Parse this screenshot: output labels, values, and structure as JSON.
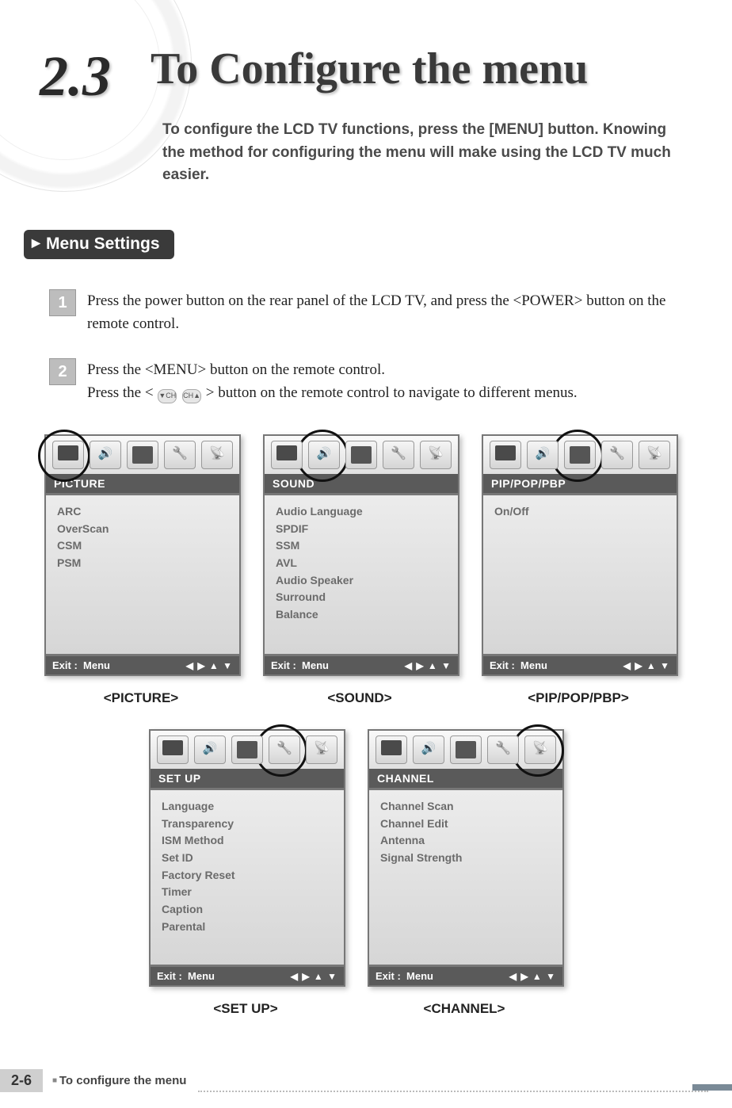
{
  "section_number": "2.3",
  "title": "To Configure the menu",
  "subtitle": "To configure the LCD TV functions, press the [MENU] button. Knowing the method for configuring the menu will make using the LCD TV much easier.",
  "tab_heading": "Menu Settings",
  "steps": {
    "s1_num": "1",
    "s1_text": "Press the power button on the rear panel of the LCD TV, and press the <POWER> button on the remote control.",
    "s2_num": "2",
    "s2_line1": "Press the <MENU> button on the remote control.",
    "s2_line2a": "Press the < ",
    "s2_line2b": " > button on the remote control to navigate to different menus.",
    "ch_down": "▼CH",
    "ch_up": "CH▲"
  },
  "panels": {
    "footer_exit": "Exit :",
    "footer_menu": "Menu",
    "footer_arrows": "◀ ▶ ▲ ▼",
    "picture": {
      "title": "PICTURE",
      "caption": "<PICTURE>",
      "items": [
        "ARC",
        "OverScan",
        "CSM",
        "PSM"
      ]
    },
    "sound": {
      "title": "SOUND",
      "caption": "<SOUND>",
      "items": [
        "Audio Language",
        "SPDIF",
        "SSM",
        "AVL",
        "Audio Speaker",
        "Surround",
        "Balance"
      ]
    },
    "pip": {
      "title": "PIP/POP/PBP",
      "caption": "<PIP/POP/PBP>",
      "items": [
        "On/Off"
      ]
    },
    "setup": {
      "title": "SET UP",
      "caption": "<SET UP>",
      "items": [
        "Language",
        "Transparency",
        "ISM Method",
        "Set ID",
        "Factory Reset",
        "Timer",
        "Caption",
        "Parental"
      ]
    },
    "channel": {
      "title": "CHANNEL",
      "caption": "<CHANNEL>",
      "items": [
        "Channel Scan",
        "Channel Edit",
        "Antenna",
        "Signal Strength"
      ]
    }
  },
  "footer": {
    "page_num": "2-6",
    "title": "To configure the menu"
  }
}
